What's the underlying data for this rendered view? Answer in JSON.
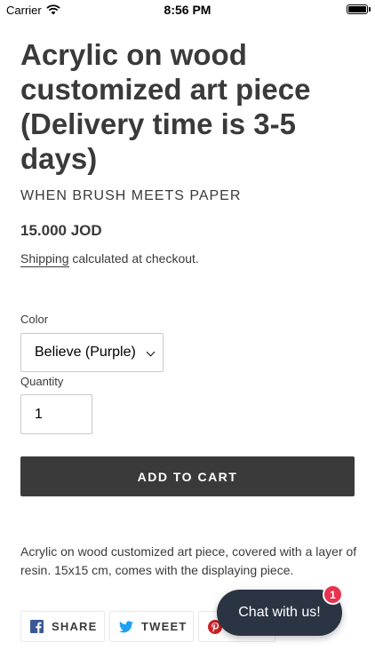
{
  "status_bar": {
    "carrier": "Carrier",
    "time": "8:56 PM"
  },
  "product": {
    "title": "Acrylic on wood customized art piece (Delivery time is 3-5 days)",
    "vendor": "WHEN BRUSH MEETS PAPER",
    "price": "15.000 JOD",
    "shipping_link": "Shipping",
    "shipping_rest": " calculated at checkout.",
    "description": " Acrylic on wood customized art piece, covered with a layer of resin. 15x15 cm, comes with the displaying piece."
  },
  "options": {
    "color_label": "Color",
    "color_value": "Believe (Purple)",
    "quantity_label": "Quantity",
    "quantity_value": "1"
  },
  "buttons": {
    "add_to_cart": "ADD TO CART"
  },
  "share": {
    "facebook": "SHARE",
    "twitter": "TWEET",
    "pinterest": ""
  },
  "chat": {
    "label": "Chat with us!",
    "badge_count": "1"
  },
  "colors": {
    "text": "#3a3a3a",
    "button_bg": "#3a3a3a",
    "chat_bg": "#2b3443",
    "badge": "#e8334f",
    "facebook": "#3b5998",
    "twitter": "#1da1f2",
    "pinterest": "#cb2027"
  },
  "icons": {
    "wifi": "wifi-icon",
    "battery": "battery-icon",
    "chevron": "chevron-down-icon",
    "facebook": "facebook-icon",
    "twitter": "twitter-icon",
    "pinterest": "pinterest-icon"
  }
}
